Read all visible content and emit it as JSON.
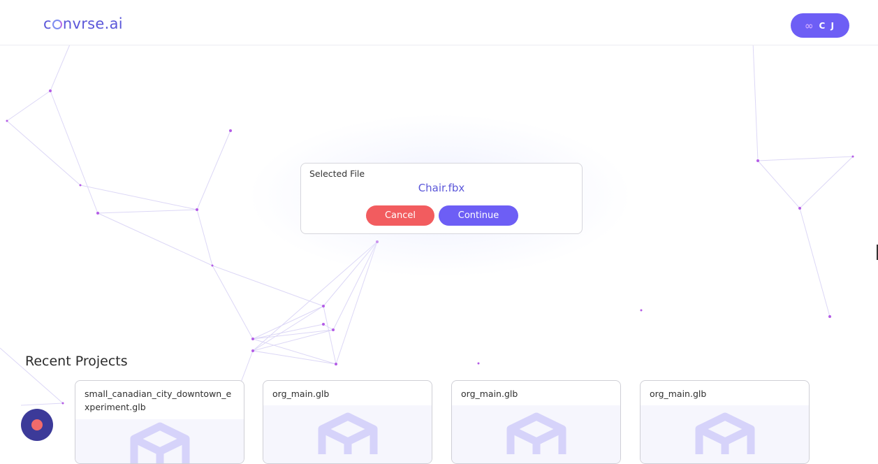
{
  "header": {
    "logo_before": "c",
    "logo_after": "nvrse.ai",
    "user_initials": "C J",
    "user_badge_icon": "infinity-icon"
  },
  "dialog": {
    "title": "Selected File",
    "file_name": "Chair.fbx",
    "cancel_label": "Cancel",
    "continue_label": "Continue"
  },
  "recent": {
    "title": "Recent Projects",
    "projects": [
      {
        "name": "small_canadian_city_downtown_experiment.glb",
        "icon": "cube-icon"
      },
      {
        "name": "org_main.glb",
        "icon": "cube-icon"
      },
      {
        "name": "org_main.glb",
        "icon": "cube-icon"
      },
      {
        "name": "org_main.glb",
        "icon": "cube-icon"
      }
    ]
  },
  "chat": {
    "icon": "chat-bubble-icon"
  },
  "colors": {
    "brand": "#5b57d9",
    "primary_button": "#6d5ef5",
    "danger_button": "#f25c5f",
    "network_line": "#d9d4f5",
    "network_node": "#b45ce6"
  }
}
